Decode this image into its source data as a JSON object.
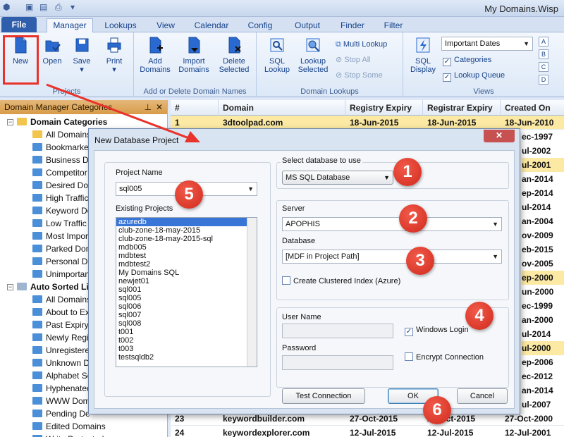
{
  "app": {
    "title": "My Domains.Wisp"
  },
  "ribbon": {
    "file_label": "File",
    "tabs": [
      "Manager",
      "Lookups",
      "View",
      "Calendar",
      "Config",
      "Output",
      "Finder",
      "Filter"
    ],
    "groups": {
      "projects": {
        "label": "Projects",
        "buttons": [
          "New",
          "Open",
          "Save",
          "Print"
        ]
      },
      "domains": {
        "label": "Add or Delete Domain Names",
        "buttons": [
          "Add Domains",
          "Import Domains",
          "Delete Selected"
        ]
      },
      "lookups": {
        "label": "Domain Lookups",
        "buttons": [
          "SQL Lookup",
          "Lookup Selected"
        ],
        "small": [
          "Multi Lookup",
          "Stop All",
          "Stop Some"
        ]
      },
      "views": {
        "label": "Views",
        "sql_display": "SQL Display",
        "dropdown": "Important Dates",
        "checks": [
          "Categories",
          "Lookup Queue"
        ],
        "letters": [
          "A",
          "B",
          "C",
          "D"
        ]
      }
    }
  },
  "left_panel": {
    "title": "Domain Manager Categories",
    "sections": [
      {
        "label": "Domain Categories",
        "items": [
          "All Domains",
          "Bookmarked",
          "Business Do",
          "Competitor",
          "Desired Dom",
          "High Traffic",
          "Keyword Do",
          "Low Traffic",
          "Most Impor",
          "Parked Dom",
          "Personal Do",
          "Unimportan"
        ]
      },
      {
        "label": "Auto Sorted Lis",
        "items": [
          "All Domains",
          "About to Exp",
          "Past Expiry D",
          "Newly Regis",
          "Unregistered",
          "Unknown D",
          "Alphabet So",
          "Hyphenated",
          "WWW Dom",
          "Pending De",
          "Edited Domains",
          "Write Protected"
        ]
      }
    ]
  },
  "grid": {
    "columns": [
      "#",
      "Domain",
      "Registry Expiry",
      "Registrar Expiry",
      "Created On"
    ],
    "rows": [
      {
        "num": "1",
        "domain": "3dtoolpad.com",
        "registry": "18-Jun-2015",
        "registrar": "18-Jun-2015",
        "created": "18-Jun-2010"
      },
      {
        "num": "23",
        "domain": "keywordbuilder.com",
        "registry": "27-Oct-2015",
        "registrar": "27-Oct-2015",
        "created": "27-Oct-2000"
      },
      {
        "num": "24",
        "domain": "keywordexplorer.com",
        "registry": "12-Jul-2015",
        "registrar": "12-Jul-2015",
        "created": "12-Jul-2001"
      }
    ],
    "created_partial": [
      "ec-1997",
      "ul-2002",
      "ul-2001",
      "an-2014",
      "ep-2014",
      "ul-2014",
      "an-2004",
      "ov-2009",
      "eb-2015",
      "ov-2005",
      "ep-2000",
      "un-2000",
      "ec-1999",
      "an-2000",
      "ul-2014",
      "ul-2000",
      "ep-2006",
      "ec-2012",
      "an-2014",
      "ul-2007"
    ]
  },
  "dialog": {
    "title": "New Database Project",
    "close_label": "✕",
    "project_name_label": "Project Name",
    "project_name_value": "sql005",
    "existing_label": "Existing Projects",
    "existing_projects": [
      "azuredb",
      "club-zone-18-may-2015",
      "club-zone-18-may-2015-sql",
      "mdb005",
      "mdbtest",
      "mdbtest2",
      "My Domains SQL",
      "newjet01",
      "sql001",
      "sql005",
      "sql006",
      "sql007",
      "sql008",
      "t001",
      "t002",
      "t003",
      "testsqldb2"
    ],
    "select_db_label": "Select database to use",
    "db_type": "MS SQL Database",
    "server_label": "Server",
    "server_value": "APOPHIS",
    "database_label": "Database",
    "database_value": "[MDF in Project Path]",
    "clustered_label": "Create Clustered Index (Azure)",
    "username_label": "User Name",
    "password_label": "Password",
    "windows_login_label": "Windows Login",
    "encrypt_label": "Encrypt Connection",
    "test_button": "Test Connection",
    "ok_button": "OK",
    "cancel_button": "Cancel"
  },
  "callouts": [
    "1",
    "2",
    "3",
    "4",
    "5",
    "6"
  ],
  "colors": {
    "callout": "#e0372a",
    "ribbon_blue": "#15428b",
    "selection": "#3875d7",
    "highlight_row": "#fbe9a4"
  }
}
